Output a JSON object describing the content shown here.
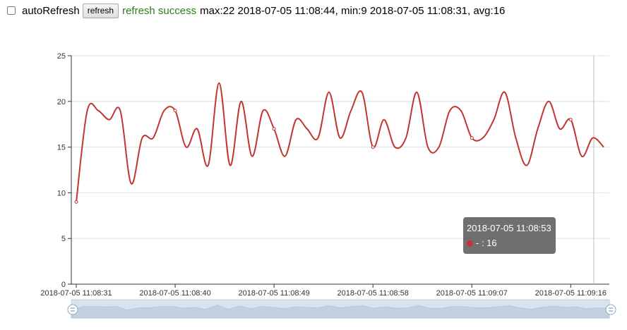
{
  "toolbar": {
    "checkbox_label": "autoRefresh",
    "checkbox_checked": false,
    "refresh_label": "refresh",
    "status_text": "refresh success",
    "stats_text": "max:22 2018-07-05 11:08:44, min:9 2018-07-05 11:08:31, avg:16",
    "status_color": "#2e7d1e"
  },
  "chart_data": {
    "type": "line",
    "title": "",
    "xlabel": "",
    "ylabel": "",
    "ylim": [
      0,
      25
    ],
    "yticks": [
      0,
      5,
      10,
      15,
      20,
      25
    ],
    "grid": true,
    "smooth": true,
    "series_color": "#c23531",
    "x_start": "2018-07-05 11:08:31",
    "x_end": "2018-07-05 11:09:18",
    "xtick_labels": [
      "2018-07-05 11:08:31",
      "2018-07-05 11:08:40",
      "2018-07-05 11:08:49",
      "2018-07-05 11:08:58",
      "2018-07-05 11:09:07",
      "2018-07-05 11:09:16"
    ],
    "series": [
      {
        "values": [
          9,
          19,
          19,
          18,
          19,
          11,
          16,
          16,
          19,
          19,
          15,
          17,
          13,
          22,
          13,
          20,
          14,
          19,
          17,
          14,
          18,
          17,
          16,
          21,
          16,
          19,
          21,
          15,
          18,
          15,
          16,
          21,
          15,
          15,
          19,
          19,
          16,
          16,
          18,
          21,
          16,
          13,
          17,
          20,
          17,
          18,
          14,
          16,
          15
        ]
      }
    ],
    "hover_index": 41
  },
  "tooltip": {
    "title": "2018-07-05 11:08:53",
    "value_text": "- : 16"
  },
  "datazoom": {
    "range_percent": [
      0,
      100
    ]
  }
}
